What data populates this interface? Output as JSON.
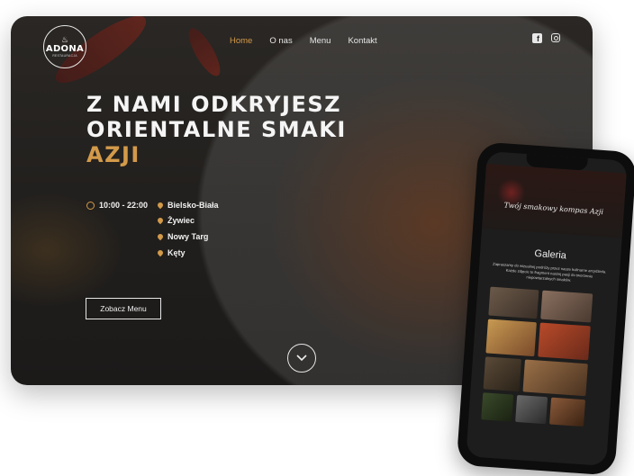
{
  "brand": {
    "logo_name": "ADONA",
    "logo_sub": "RESTAURACJA"
  },
  "nav": {
    "items": [
      {
        "label": "Home",
        "active": true
      },
      {
        "label": "O nas",
        "active": false
      },
      {
        "label": "Menu",
        "active": false
      },
      {
        "label": "Kontakt",
        "active": false
      }
    ]
  },
  "social": {
    "facebook_icon": "facebook-icon",
    "instagram_icon": "instagram-icon"
  },
  "hero": {
    "line1": "Z NAMI ODKRYJESZ",
    "line2": "ORIENTALNE SMAKI",
    "accent": "AZJI",
    "hours": "10:00 - 22:00",
    "locations": [
      "Bielsko-Biała",
      "Żywiec",
      "Nowy Targ",
      "Kęty"
    ],
    "cta": "Zobacz Menu"
  },
  "mobile": {
    "tagline": "Twój smakowy kompas Azji",
    "gallery_title": "Galeria",
    "gallery_desc": "Zapraszamy do wizualnej podróży przez nasze kulinarne arcydzieła. Każde zdjęcie to fragment naszej pasji do tworzenia niepowtarzalnych smaków."
  },
  "colors": {
    "accent": "#d39a4a",
    "background": "#211f1d",
    "text": "#f5f5f5"
  }
}
